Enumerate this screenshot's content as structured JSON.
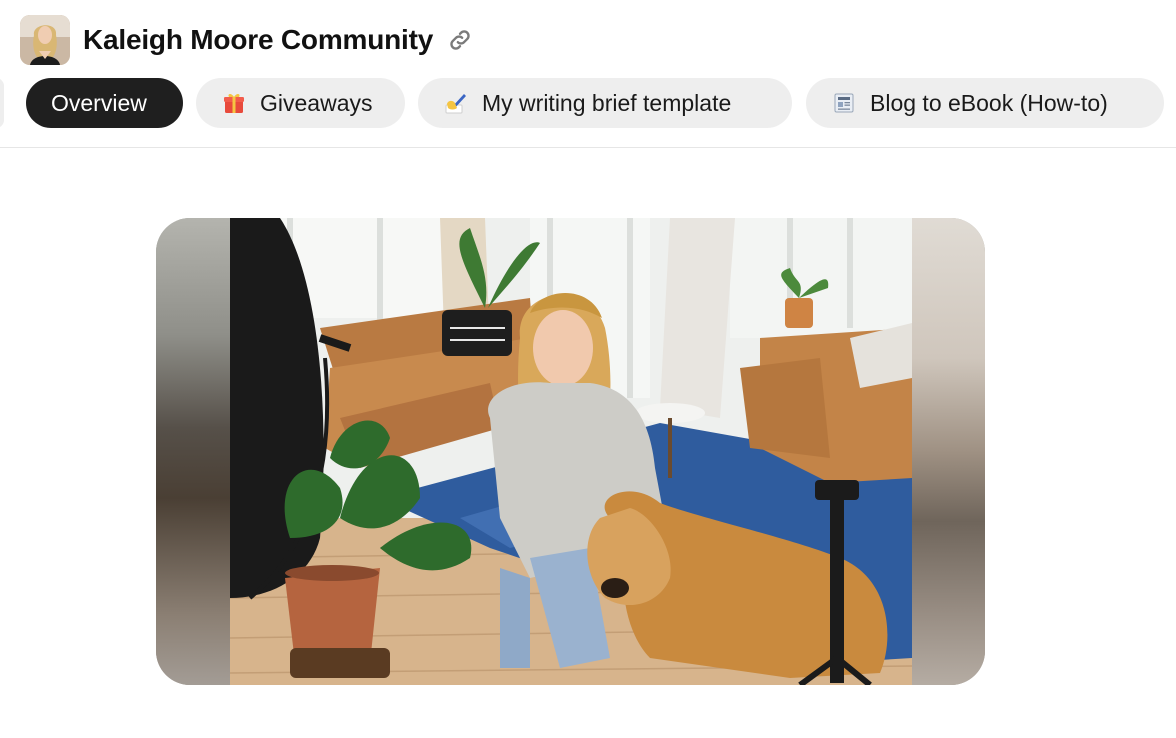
{
  "community": {
    "name": "Kaleigh Moore Community",
    "avatar_icon": "profile-photo",
    "link_icon": "link-icon"
  },
  "tabs": [
    {
      "label": "Overview",
      "icon": "",
      "active": true
    },
    {
      "label": "Giveaways",
      "icon": "gift-emoji",
      "active": false
    },
    {
      "label": "My writing brief template",
      "icon": "writing-hand-emoji",
      "active": false
    },
    {
      "label": "Blog to eBook (How-to)",
      "icon": "newspaper-emoji",
      "active": false
    }
  ],
  "colors": {
    "active_tab_bg": "#1f1f1f",
    "tab_bg": "#eeeeee",
    "rug_blue": "#2f5c9e",
    "sofa_tan": "#c88a4e"
  },
  "media": {
    "type": "photo",
    "alt_description": "Woman in gray sweater sitting with golden retriever in a bright living room"
  }
}
